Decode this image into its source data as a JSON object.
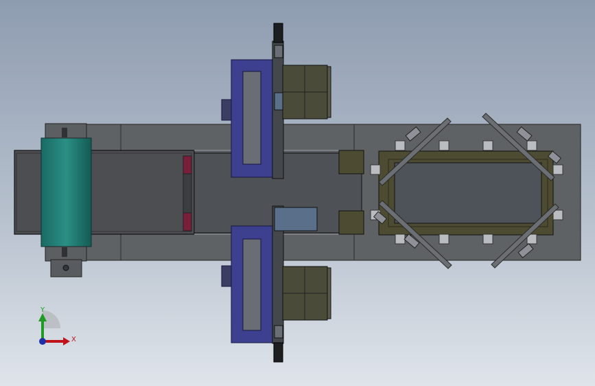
{
  "viewport": {
    "background_top": "#8e9cb0",
    "background_bottom": "#dfe4ea",
    "view_orientation": "top"
  },
  "model": {
    "components": [
      {
        "name": "base-frame",
        "color": "#5f6264"
      },
      {
        "name": "belt-conveyor",
        "color": "#4c4e52"
      },
      {
        "name": "drive-drum",
        "color": "#1f7d74"
      },
      {
        "name": "gantry-frame-top",
        "color": "#3d3f8f"
      },
      {
        "name": "gantry-frame-bottom",
        "color": "#3d3f8f"
      },
      {
        "name": "control-cabinet-top",
        "color": "#4b4b3a"
      },
      {
        "name": "control-cabinet-bottom",
        "color": "#4b4b3a"
      },
      {
        "name": "stop-block",
        "color": "#7a1f3b"
      },
      {
        "name": "fixture-frame",
        "color": "#4d4c33"
      },
      {
        "name": "fixture-plate",
        "color": "#4e5259"
      }
    ]
  },
  "triad": {
    "x_label": "X",
    "y_label": "Y",
    "x_color": "#c0121a",
    "y_color": "#1d9b22",
    "z_color": "#1e2fa8"
  }
}
